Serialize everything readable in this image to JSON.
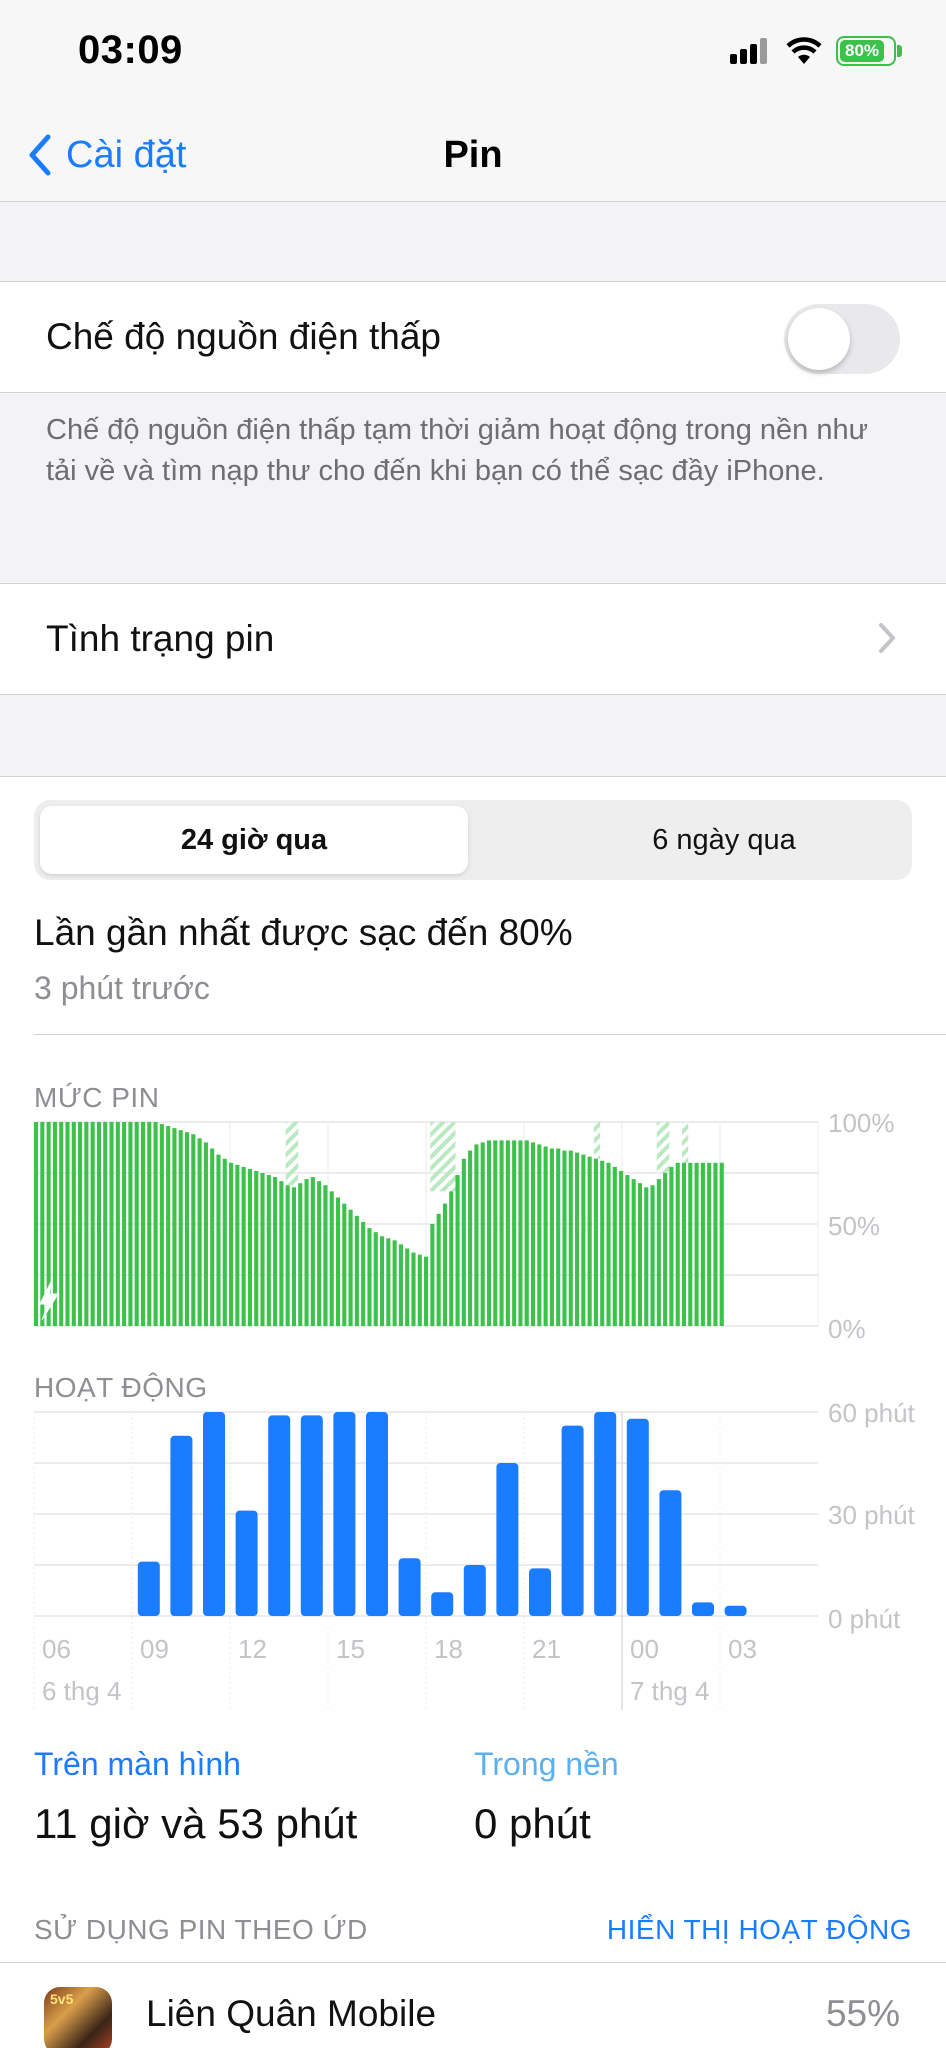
{
  "status_bar": {
    "time": "03:09",
    "battery": "80%"
  },
  "nav": {
    "back_label": "Cài đặt",
    "title": "Pin"
  },
  "low_power": {
    "label": "Chế độ nguồn điện thấp",
    "enabled": false,
    "footnote": "Chế độ nguồn điện thấp tạm thời giảm hoạt động trong nền như tải về và tìm nạp thư cho đến khi bạn có thể sạc đầy iPhone."
  },
  "battery_health": {
    "label": "Tình trạng pin"
  },
  "segments": {
    "active": "24 giờ qua",
    "other": "6 ngày qua"
  },
  "last_charge": {
    "title": "Lần gần nhất được sạc đến 80%",
    "subtitle": "3 phút trước"
  },
  "battery_chart": {
    "label": "MỨC PIN",
    "y_labels": [
      "100%",
      "50%",
      "0%"
    ]
  },
  "activity_chart": {
    "label": "HOẠT ĐỘNG",
    "y_labels": [
      "60 phút",
      "30 phút",
      "0 phút"
    ],
    "x_labels": [
      "06",
      "09",
      "12",
      "15",
      "18",
      "21",
      "00",
      "03"
    ],
    "date_labels": [
      "6 thg 4",
      "7 thg 4"
    ]
  },
  "chart_data": [
    {
      "type": "bar",
      "title": "MỨC PIN",
      "ylabel": "",
      "ylim": [
        0,
        100
      ],
      "values": [
        100,
        100,
        100,
        100,
        100,
        100,
        100,
        100,
        100,
        100,
        100,
        100,
        100,
        100,
        100,
        100,
        100,
        100,
        100,
        100,
        99,
        98,
        97,
        96,
        95,
        94,
        92,
        90,
        87,
        84,
        82,
        80,
        79,
        78,
        77,
        76,
        75,
        74,
        73,
        71,
        69,
        68,
        70,
        72,
        73,
        71,
        69,
        66,
        63,
        60,
        57,
        54,
        51,
        48,
        46,
        44,
        43,
        42,
        40,
        38,
        36,
        35,
        34,
        50,
        55,
        60,
        66,
        74,
        82,
        86,
        89,
        90,
        91,
        91,
        91,
        91,
        91,
        91,
        91,
        90,
        89,
        88,
        87,
        87,
        86,
        86,
        85,
        84,
        83,
        82,
        81,
        80,
        78,
        76,
        74,
        72,
        70,
        68,
        69,
        72,
        75,
        78,
        80,
        80,
        80,
        80,
        80,
        80,
        80,
        80
      ],
      "charging_overlay_ranges": [
        [
          40,
          42
        ],
        [
          63,
          67
        ],
        [
          89,
          90
        ],
        [
          99,
          101
        ],
        [
          103,
          104
        ]
      ]
    },
    {
      "type": "bar",
      "title": "HOẠT ĐỘNG",
      "ylabel": "",
      "ylim": [
        0,
        60
      ],
      "categories": [
        "06",
        "07",
        "08",
        "09",
        "10",
        "11",
        "12",
        "13",
        "14",
        "15",
        "16",
        "17",
        "18",
        "19",
        "20",
        "21",
        "22",
        "23",
        "00",
        "01",
        "02",
        "03"
      ],
      "values": [
        0,
        0,
        0,
        16,
        53,
        60,
        31,
        59,
        59,
        60,
        60,
        17,
        7,
        15,
        45,
        14,
        56,
        60,
        58,
        37,
        4,
        3
      ]
    }
  ],
  "screen_time": {
    "on_screen_label": "Trên màn hình",
    "on_screen_value": "11 giờ và 53 phút",
    "background_label": "Trong nền",
    "background_value": "0 phút"
  },
  "usage": {
    "header": "SỬ DỤNG PIN THEO ỨD",
    "toggle_label": "HIỂN THỊ HOẠT ĐỘNG",
    "apps": [
      {
        "name": "Liên Quân Mobile",
        "percent": "55%",
        "icon": "game-icon",
        "icon_badge": "5v5"
      }
    ]
  }
}
